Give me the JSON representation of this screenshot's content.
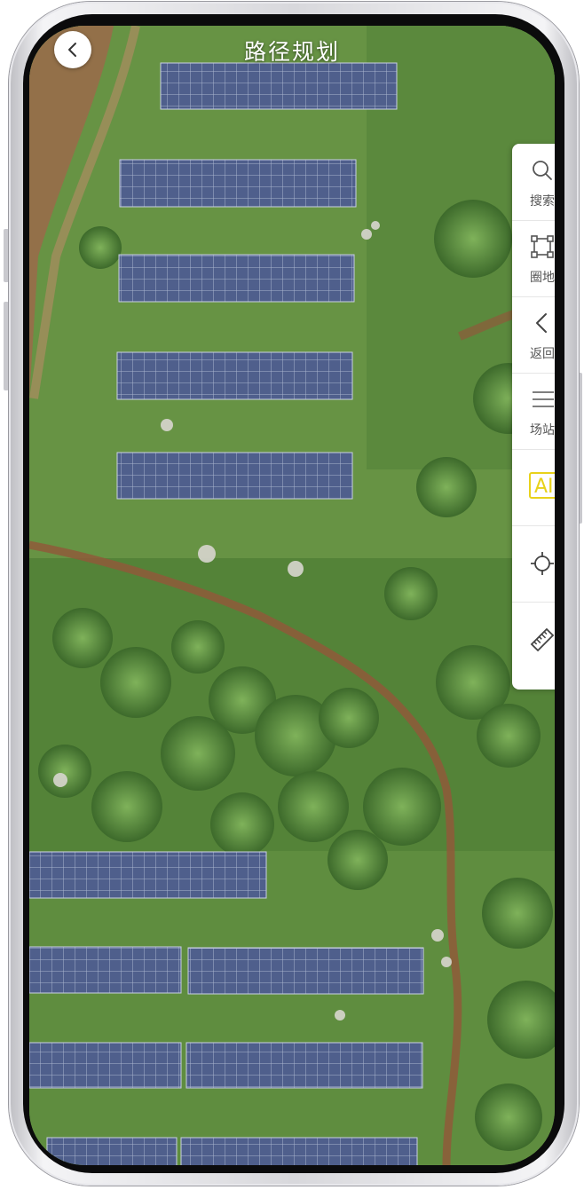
{
  "header": {
    "title": "路径规划",
    "back_icon": "chevron-left-icon"
  },
  "toolbar": {
    "items": [
      {
        "label": "搜索",
        "icon": "search-icon"
      },
      {
        "label": "圈地",
        "icon": "polygon-draw-icon"
      },
      {
        "label": "返回",
        "icon": "chevron-left-icon"
      },
      {
        "label": "场站",
        "icon": "menu-lines-icon"
      },
      {
        "label": "AI",
        "icon": "ai-badge-icon"
      },
      {
        "label": "",
        "icon": "locate-crosshair-icon"
      },
      {
        "label": "",
        "icon": "ruler-icon"
      }
    ]
  },
  "colors": {
    "panel": "#4e5f8a",
    "vegetation": "#5d8a3c",
    "dirt_path": "#9a5a3a",
    "ai_accent": "#e8d21a"
  }
}
